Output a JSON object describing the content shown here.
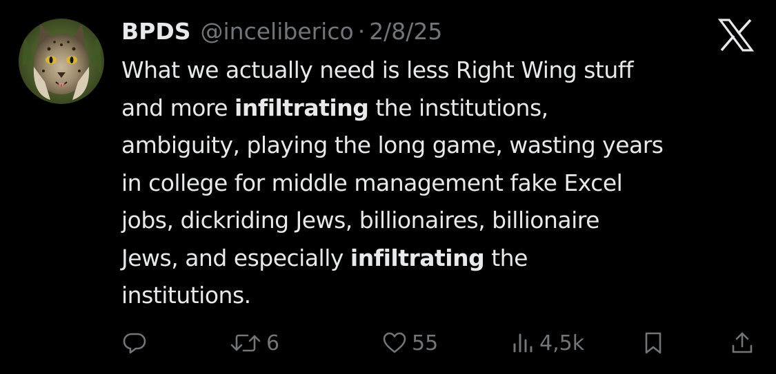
{
  "tweet": {
    "author": {
      "display_name": "BPDS",
      "handle": "@inceliberico",
      "avatar_icon": "lynx-avatar"
    },
    "separator": "·",
    "date": "2/8/25",
    "platform_icon": "x-logo-icon",
    "text_segments": {
      "l1": "What we actually need is less Right Wing stuff",
      "l2a": "and more ",
      "l2b": "infiltrating",
      "l2c": " the institutions,",
      "l3": "ambiguity, playing the long game, wasting years",
      "l4": "in college for middle management fake Excel",
      "l5": "jobs, dickriding Jews, billionaires, billionaire",
      "l6a": "Jews, and especially ",
      "l6b": "infiltrating",
      "l6c": " the",
      "l7": "institutions."
    },
    "actions": {
      "reply": {
        "icon": "reply-icon",
        "count": ""
      },
      "repost": {
        "icon": "repost-icon",
        "count": "6"
      },
      "like": {
        "icon": "heart-icon",
        "count": "55"
      },
      "views": {
        "icon": "views-icon",
        "count": "4,5k"
      },
      "bookmark": {
        "icon": "bookmark-icon",
        "count": ""
      },
      "share": {
        "icon": "share-icon",
        "count": ""
      }
    }
  },
  "colors": {
    "background": "#000000",
    "primary_text": "#e7e9ea",
    "secondary_text": "#71767b"
  }
}
